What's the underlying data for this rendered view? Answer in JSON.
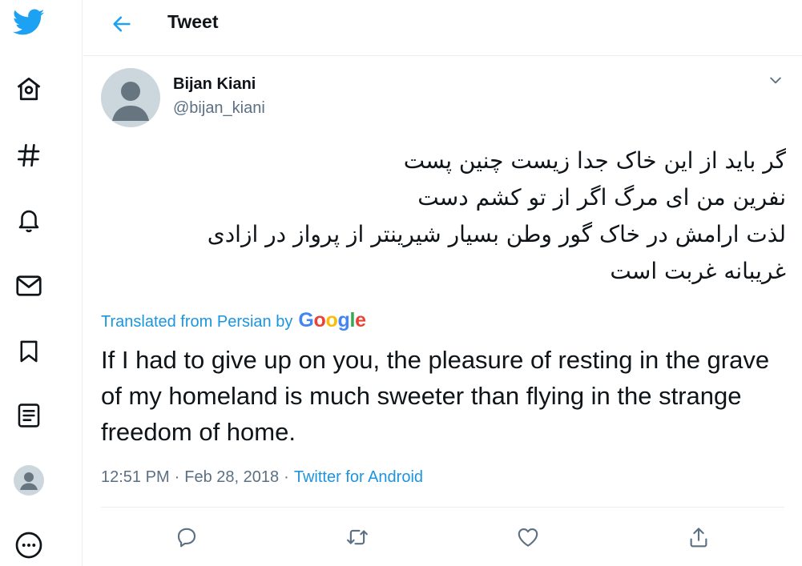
{
  "nav": {
    "items": [
      {
        "icon": "twitter-logo-icon"
      },
      {
        "icon": "home-icon"
      },
      {
        "icon": "explore-hashtag-icon"
      },
      {
        "icon": "notifications-bell-icon"
      },
      {
        "icon": "messages-envelope-icon"
      },
      {
        "icon": "bookmarks-icon"
      },
      {
        "icon": "lists-icon"
      },
      {
        "icon": "profile-avatar-icon"
      },
      {
        "icon": "more-icon"
      }
    ]
  },
  "header": {
    "back_icon": "back-arrow-icon",
    "title": "Tweet"
  },
  "tweet": {
    "user_name": "Bijan Kiani",
    "user_handle": "@bijan_kiani",
    "menu_icon": "chevron-down-icon",
    "persian_lines": [
      "گر باید از این خاک جدا زیست چنین پست",
      "نفرین من ای مرگ اگر از تو کشم دست",
      "لذت ارامش در خاک گور وطن بسیار شیرینتر از پرواز در ازادی",
      "غریبانه غربت است"
    ],
    "translated_label": "Translated from Persian by",
    "translation_provider": "Google",
    "translation_text": "If I had to give up on you, the pleasure of resting in the grave of my homeland is much sweeter than flying in the strange freedom of home.",
    "time": "12:51 PM",
    "separator": "·",
    "date": "Feb 28, 2018",
    "source": "Twitter for Android"
  },
  "actions": [
    {
      "icon": "reply-icon"
    },
    {
      "icon": "retweet-icon"
    },
    {
      "icon": "like-heart-icon"
    },
    {
      "icon": "share-icon"
    }
  ],
  "colors": {
    "accent": "#1da1f2",
    "link": "#1b95e0",
    "text": "#0f1419",
    "secondary": "#5b7083",
    "icon": "#0f1419",
    "action_icon": "#5b7083",
    "border": "#ebeef0"
  }
}
